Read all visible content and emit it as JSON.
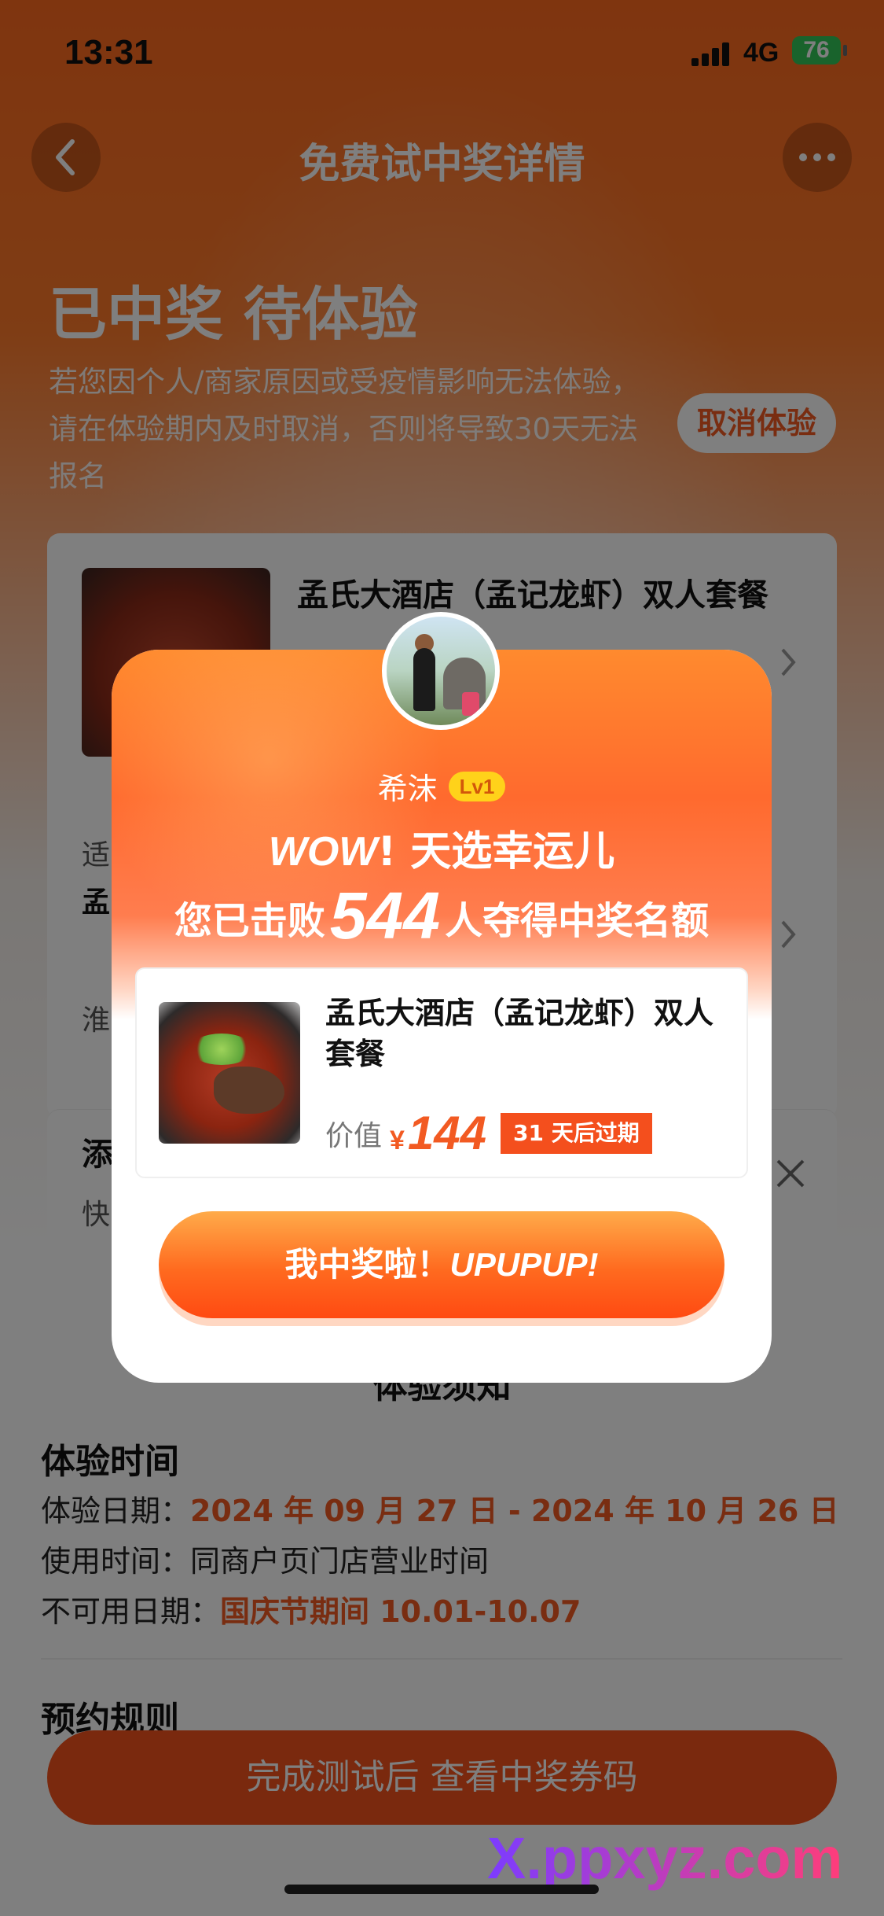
{
  "status_bar": {
    "time": "13:31",
    "network": "4G",
    "battery": "76"
  },
  "nav": {
    "title": "免费试中奖详情"
  },
  "status_heading": "已中奖 待体验",
  "notice": "若您因个人/商家原因或受疫情影响无法体验，请在体验期内及时取消，否则将导致30天无法报名",
  "cancel_button": "取消体验",
  "bg_card": {
    "title": "孟氏大酒店（孟记龙虾）双人套餐",
    "row1_label": "适",
    "row2_label": "孟",
    "row3_label": "淮",
    "row4_label": "添",
    "row5_label": "快"
  },
  "section_center_title": "体验须知",
  "experience_time": {
    "heading": "体验时间",
    "date_label": "体验日期：",
    "date_value": "2024 年 09 月 27 日 - 2024 年 10 月 26 日",
    "use_label": "使用时间：",
    "use_value": "同商户页门店营业时间",
    "unavailable_label": "不可用日期：",
    "unavailable_value": "国庆节期间 10.01-10.07"
  },
  "booking_heading": "预约规则",
  "bottom_button": "完成测试后 查看中奖券码",
  "modal": {
    "username": "希沫",
    "level": "Lv1",
    "wow": "WOW",
    "headline_rest": "! 天选幸运儿",
    "subline_pre": "您已击败",
    "beaten_count": "544",
    "subline_post": "人夺得中奖名额",
    "prize_title": "孟氏大酒店（孟记龙虾）双人套餐",
    "price_label": "价值",
    "price_currency": "¥",
    "price_value": "144",
    "expire_tag": "31 天后过期",
    "claim_cn": "我中奖啦！",
    "claim_en": "UPUPUP!"
  },
  "watermark": "X.ppxyz.com"
}
